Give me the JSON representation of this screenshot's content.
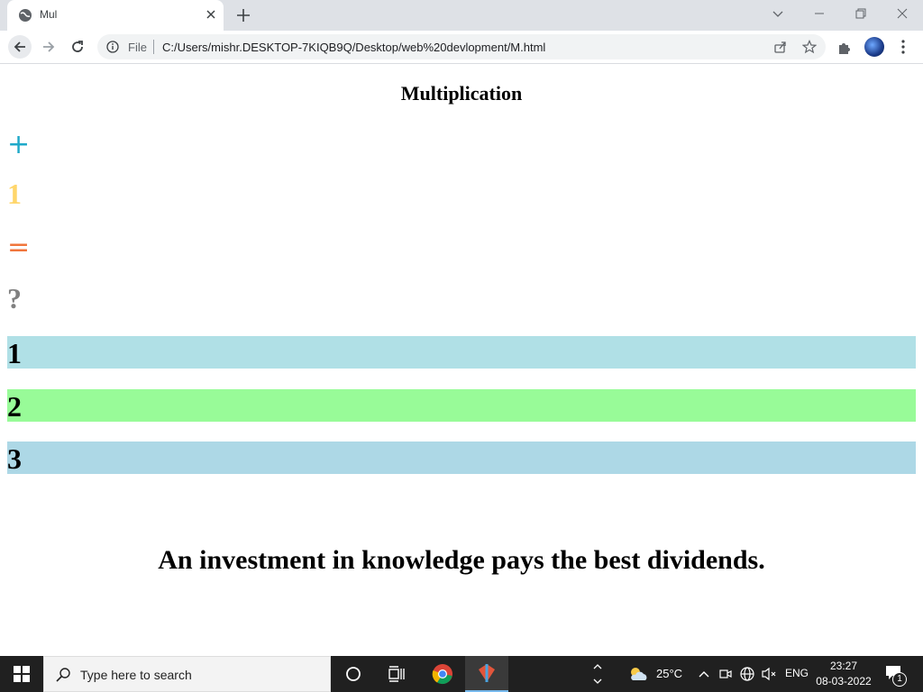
{
  "browser": {
    "tab_title": "Mul",
    "omnibox_scheme": "File",
    "url": "C:/Users/mishr.DESKTOP-7KIQB9Q/Desktop/web%20devlopment/M.html"
  },
  "page": {
    "heading": "Multiplication",
    "operator_symbol": "+",
    "operand": "1",
    "equals_symbol": "=",
    "question_mark": "?",
    "options": [
      "1",
      "2",
      "3"
    ],
    "option_colors": [
      "#b0e0e6",
      "#98fb98",
      "#add8e6"
    ],
    "quote": "An investment in knowledge pays the best dividends."
  },
  "taskbar": {
    "search_placeholder": "Type here to search",
    "temperature": "25°C",
    "language": "ENG",
    "time": "23:27",
    "date": "08-03-2022",
    "notification_count": "1"
  }
}
